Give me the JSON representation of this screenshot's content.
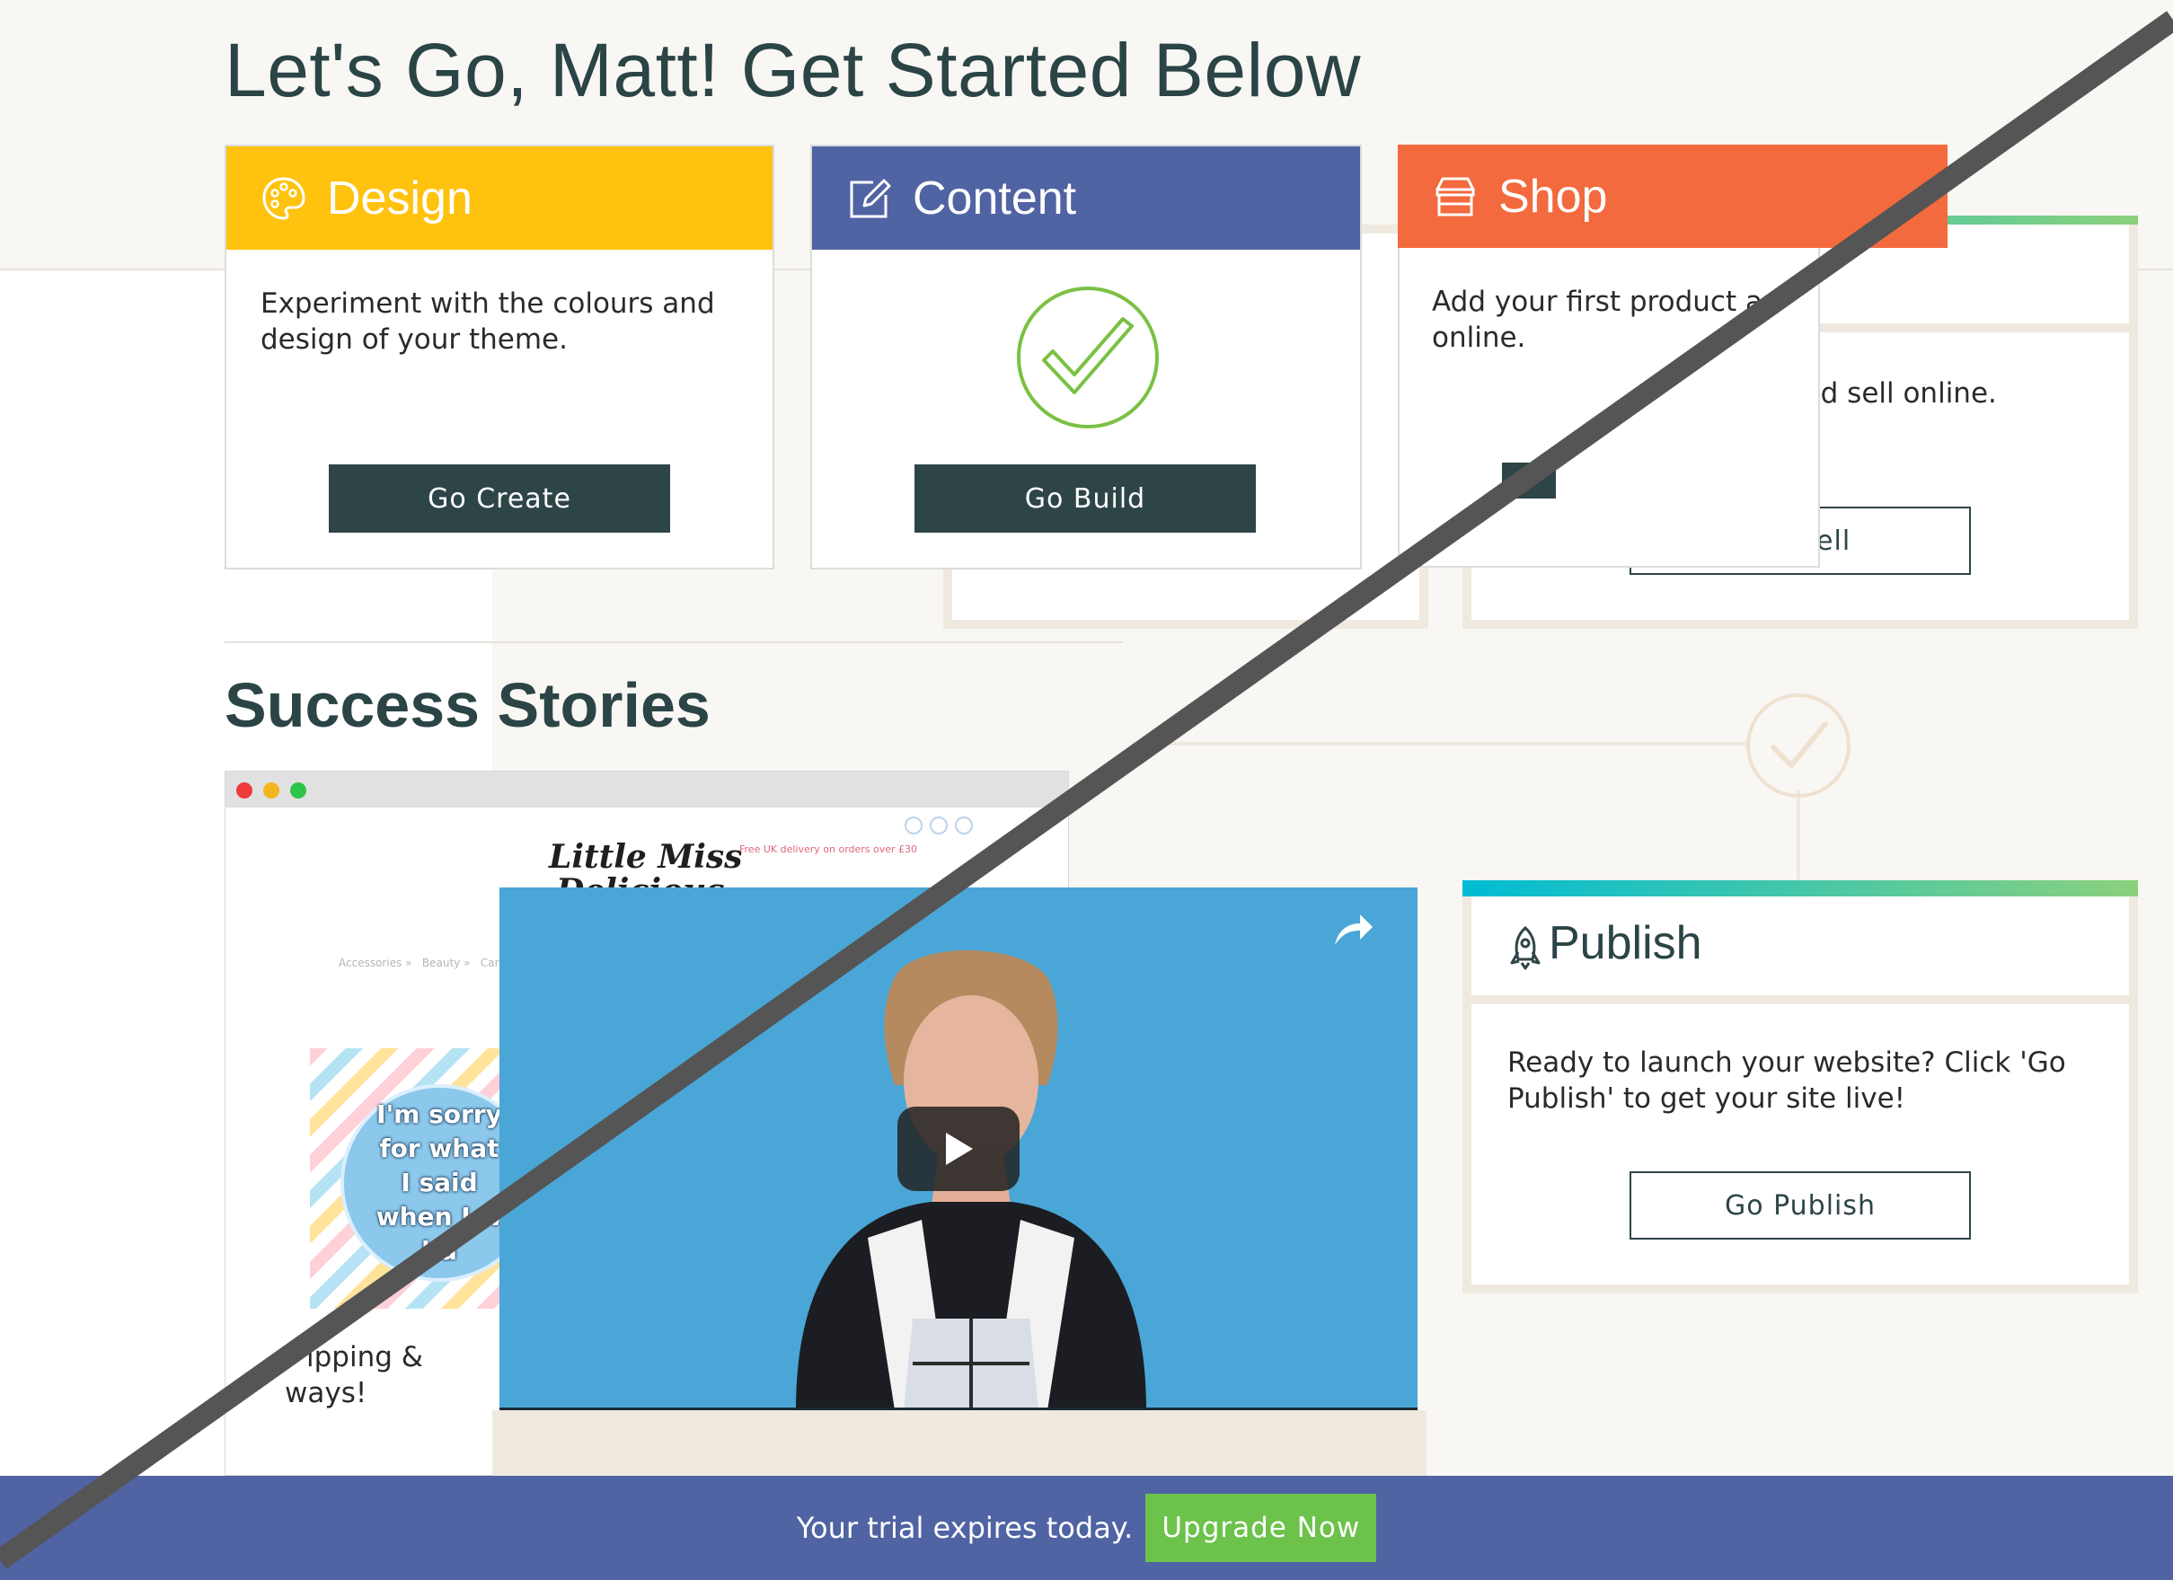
{
  "header": {
    "title": "Let's Go, Matt! Get Started Below"
  },
  "cards": {
    "design": {
      "label": "Design",
      "text": "Experiment with the colours and design of your theme.",
      "button": "Go Create",
      "color": "#ffc20e"
    },
    "content": {
      "label": "Content",
      "button": "Go Build",
      "color": "#5063a3"
    },
    "shop": {
      "label": "Shop",
      "text": "Add your first product ar online.",
      "color": "#f26a3d"
    }
  },
  "right_panels": {
    "shop_text_fragment": "rst product and sell online.",
    "go_sell": "Go Sell",
    "publish": {
      "label": "Publish",
      "text": "Ready to launch your website? Click 'Go Publish' to get your site live!",
      "button": "Go Publish"
    }
  },
  "success": {
    "title": "Success Stories",
    "mock_site": {
      "logo_line1": "Little Miss",
      "logo_line2": "Delicious",
      "promo": "Free UK delivery on orders over £30",
      "nav": "Accessories »   Beauty »   Cards   Collections »   Home »   Jewellery »   Mystery Packs",
      "badge_lines": [
        "I'm sorry",
        "for what",
        "I said",
        "when I w",
        "hu"
      ],
      "caption_line1": "ipping &",
      "caption_line2": "ways!"
    }
  },
  "footer": {
    "text": "Your trial expires today.",
    "button": "Upgrade Now"
  },
  "colors": {
    "accent_teal": "#00bcd4",
    "accent_green": "#8bd17c",
    "check_green": "#7ac143"
  }
}
